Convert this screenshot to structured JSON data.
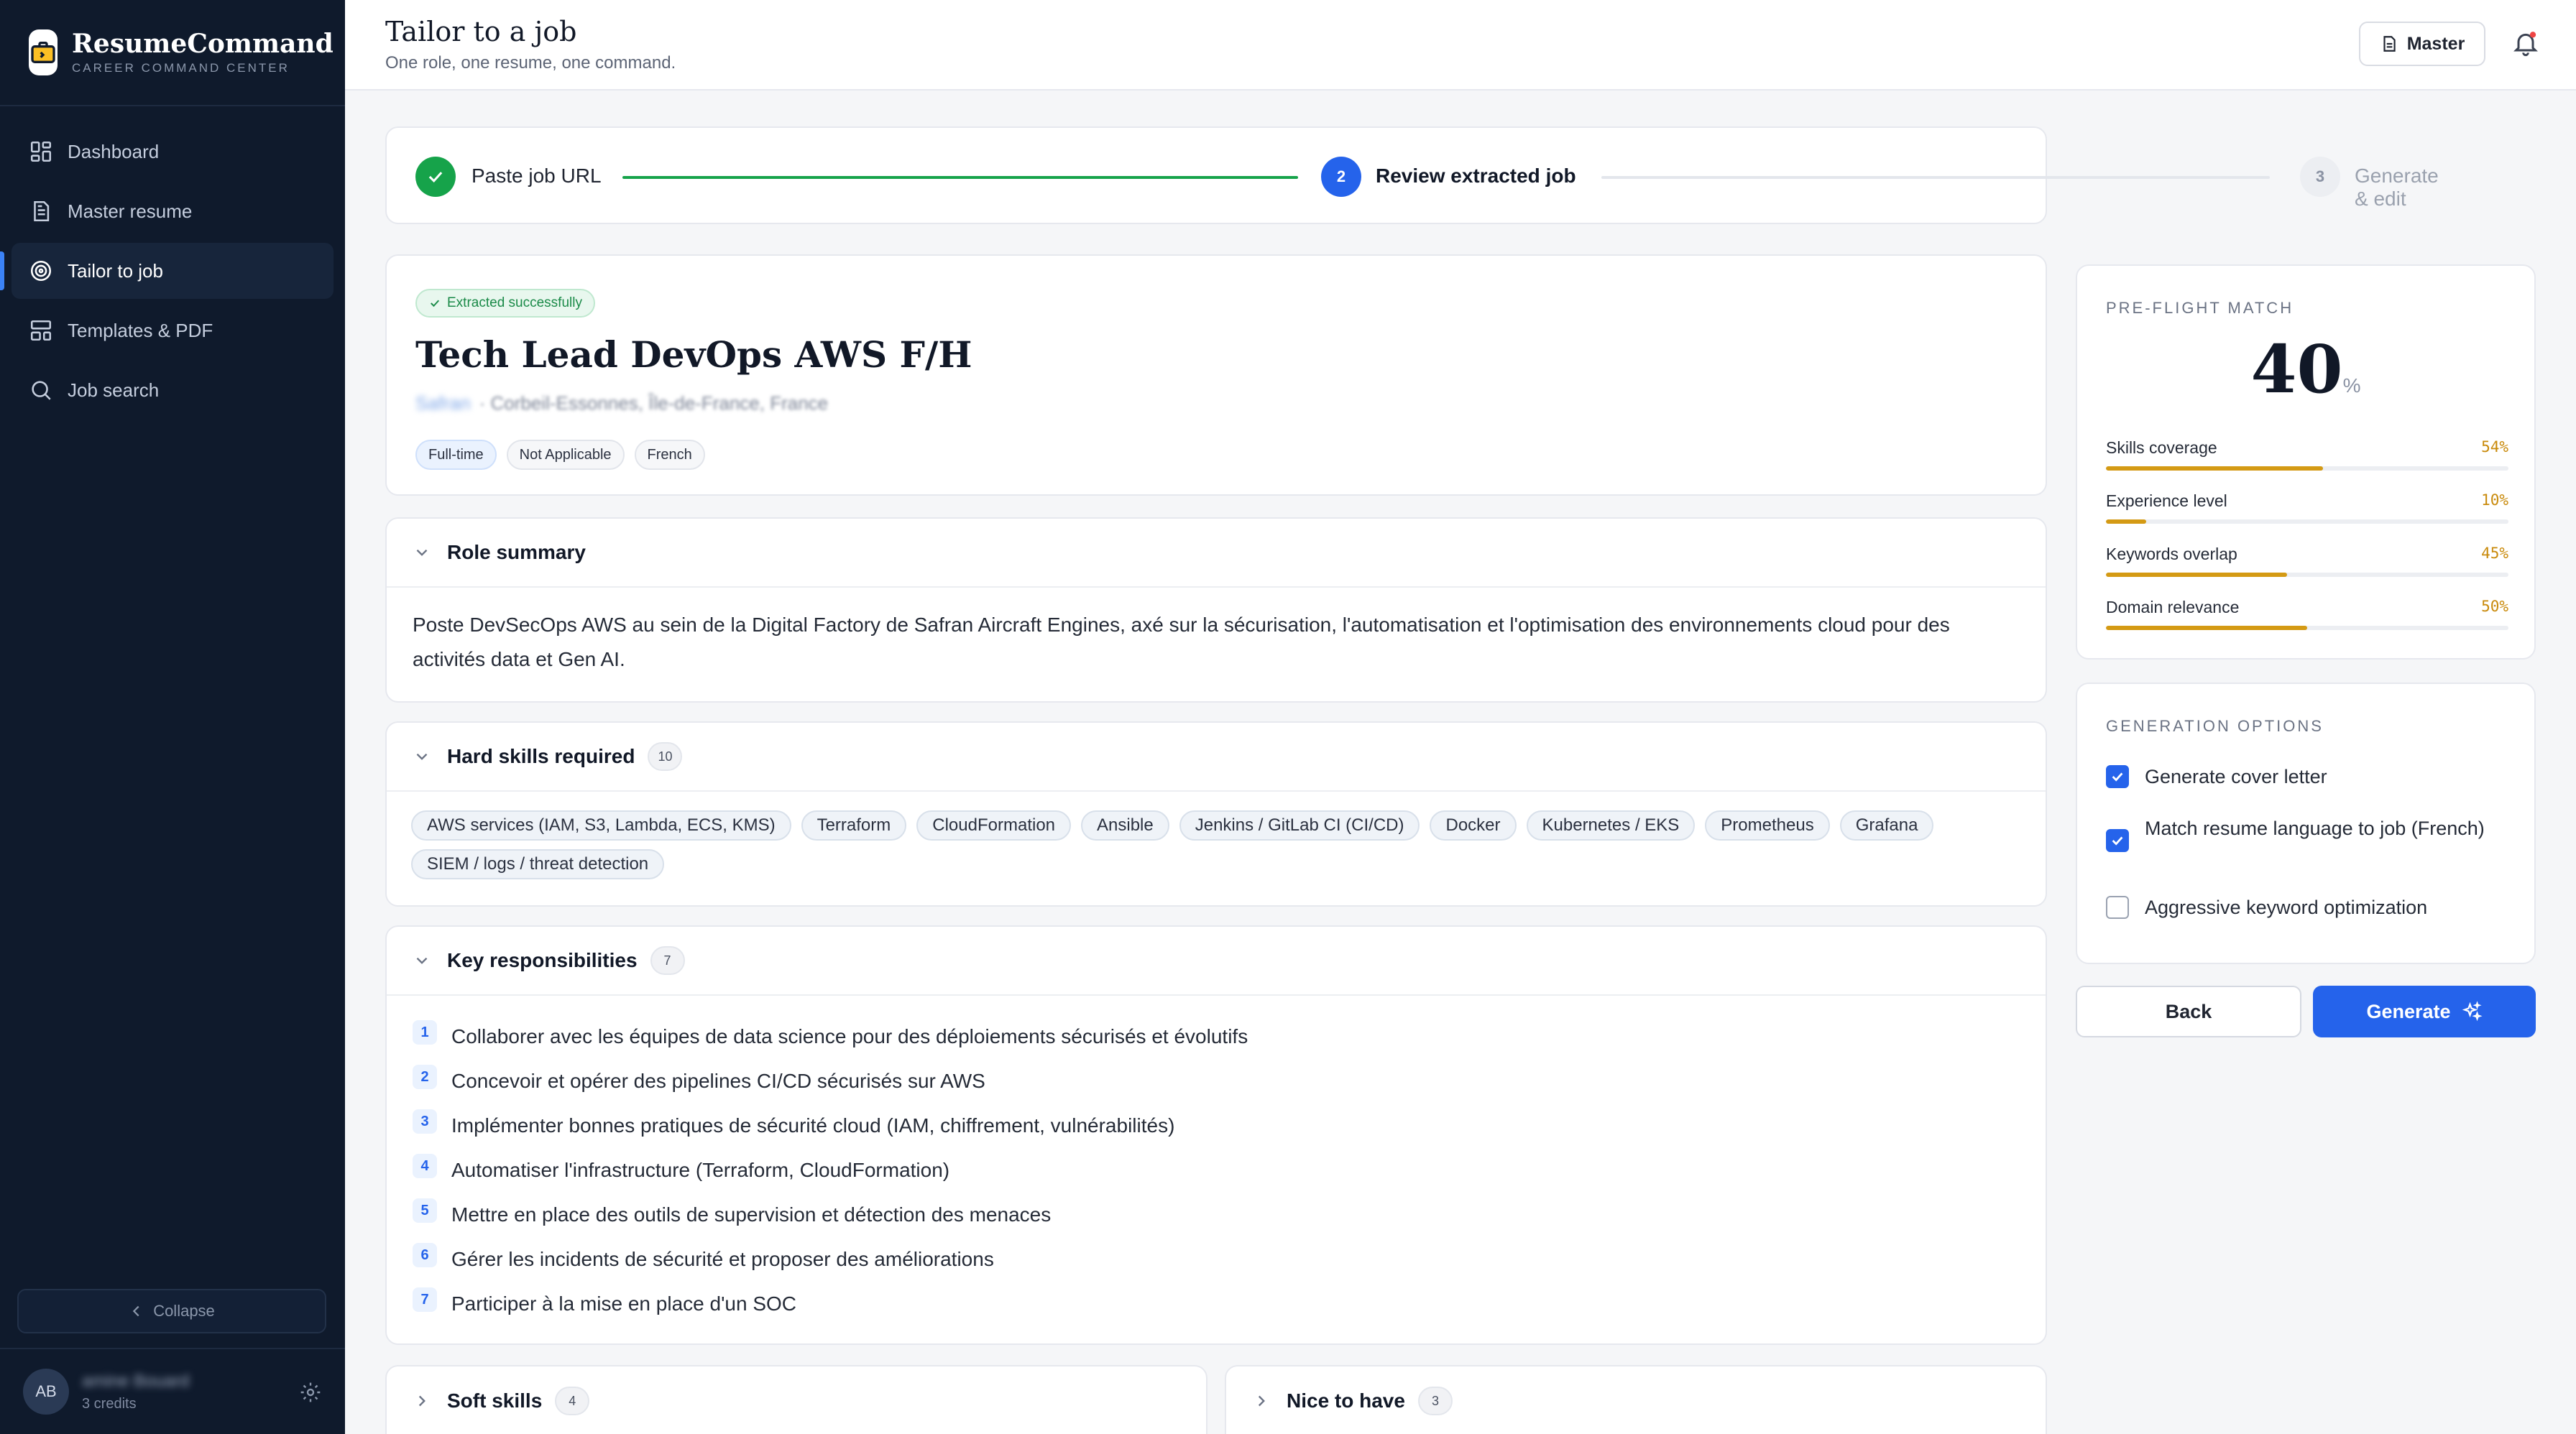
{
  "app": {
    "name": "ResumeCommand",
    "tagline": "CAREER COMMAND CENTER"
  },
  "sidebar": {
    "items": [
      {
        "label": "Dashboard",
        "icon": "grid-icon"
      },
      {
        "label": "Master resume",
        "icon": "document-icon"
      },
      {
        "label": "Tailor to job",
        "icon": "target-icon",
        "active": true
      },
      {
        "label": "Templates & PDF",
        "icon": "layout-icon"
      },
      {
        "label": "Job search",
        "icon": "search-icon"
      }
    ],
    "collapse_label": "Collapse",
    "user": {
      "initials": "AB",
      "name": "amine Bouard",
      "credits": "3 credits"
    }
  },
  "header": {
    "title": "Tailor to a job",
    "subtitle": "One role, one resume, one command.",
    "master_label": "Master"
  },
  "stepper": {
    "steps": [
      {
        "number": "1",
        "label": "Paste job URL",
        "state": "done"
      },
      {
        "number": "2",
        "label": "Review extracted job",
        "state": "current"
      },
      {
        "number": "3",
        "label": "Generate & edit",
        "state": "upcoming"
      }
    ]
  },
  "job": {
    "status_badge": "Extracted successfully",
    "title": "Tech Lead DevOps AWS F/H",
    "company": "Safran",
    "location": "· Corbeil-Essonnes, Île-de-France, France",
    "chips": [
      "Full-time",
      "Not Applicable",
      "French"
    ]
  },
  "role_summary": {
    "heading": "Role summary",
    "text": "Poste DevSecOps AWS au sein de la Digital Factory de Safran Aircraft Engines, axé sur la sécurisation, l'automatisation et l'optimisation des environnements cloud pour des activités data et Gen AI."
  },
  "hard_skills": {
    "heading": "Hard skills required",
    "count": "10",
    "items": [
      "AWS services (IAM, S3, Lambda, ECS, KMS)",
      "Terraform",
      "CloudFormation",
      "Ansible",
      "Jenkins / GitLab CI (CI/CD)",
      "Docker",
      "Kubernetes / EKS",
      "Prometheus",
      "Grafana",
      "SIEM / logs / threat detection"
    ]
  },
  "responsibilities": {
    "heading": "Key responsibilities",
    "count": "7",
    "items": [
      {
        "n": "1",
        "text": "Collaborer avec les équipes de data science pour des déploiements sécurisés et évolutifs"
      },
      {
        "n": "2",
        "text": "Concevoir et opérer des pipelines CI/CD sécurisés sur AWS"
      },
      {
        "n": "3",
        "text": "Implémenter bonnes pratiques de sécurité cloud (IAM, chiffrement, vulnérabilités)"
      },
      {
        "n": "4",
        "text": "Automatiser l'infrastructure (Terraform, CloudFormation)"
      },
      {
        "n": "5",
        "text": "Mettre en place des outils de supervision et détection des menaces"
      },
      {
        "n": "6",
        "text": "Gérer les incidents de sécurité et proposer des améliorations"
      },
      {
        "n": "7",
        "text": "Participer à la mise en place d'un SOC"
      }
    ]
  },
  "soft_skills": {
    "heading": "Soft skills",
    "count": "4"
  },
  "nice_to_have": {
    "heading": "Nice to have",
    "count": "3"
  },
  "preflight": {
    "label": "PRE-FLIGHT MATCH",
    "score": "40",
    "score_unit": "%",
    "metrics": [
      {
        "label": "Skills coverage",
        "value": "54%",
        "fraction": 0.54
      },
      {
        "label": "Experience level",
        "value": "10%",
        "fraction": 0.1
      },
      {
        "label": "Keywords overlap",
        "value": "45%",
        "fraction": 0.45
      },
      {
        "label": "Domain relevance",
        "value": "50%",
        "fraction": 0.5
      }
    ]
  },
  "generation_options": {
    "label": "GENERATION OPTIONS",
    "options": [
      {
        "label": "Generate cover letter",
        "checked": true
      },
      {
        "label": "Match resume language to job (French)",
        "checked": true
      },
      {
        "label": "Aggressive keyword optimization",
        "checked": false
      }
    ]
  },
  "actions": {
    "back_label": "Back",
    "generate_label": "Generate"
  },
  "colors": {
    "accent": "#2563eb",
    "success": "#16a34a",
    "warning": "#d49a14",
    "sidebar_bg": "#0f1a2c"
  }
}
